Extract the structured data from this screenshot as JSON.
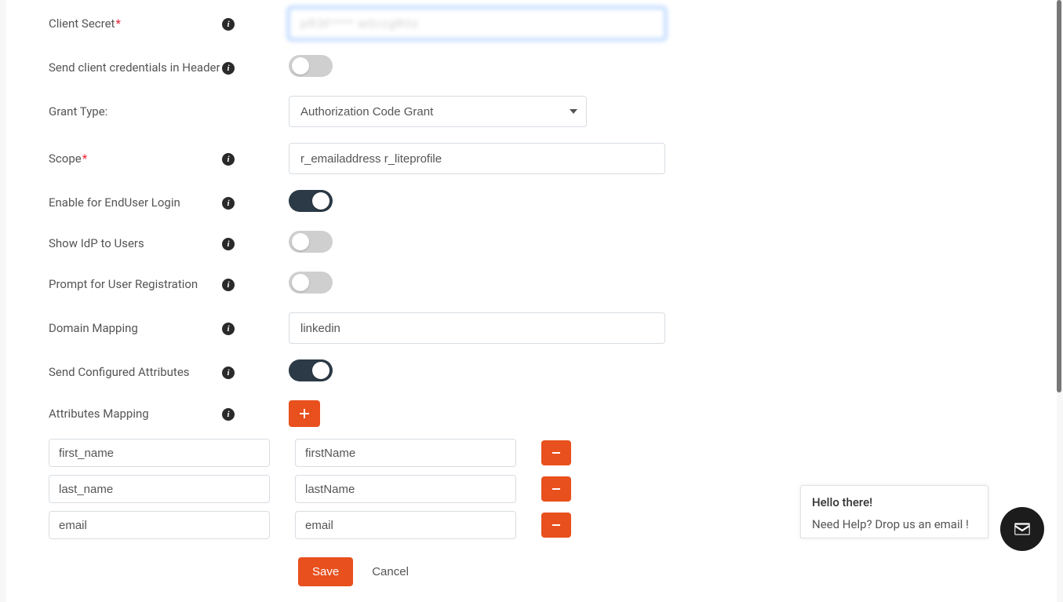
{
  "form": {
    "client_secret": {
      "label": "Client Secret",
      "value": "pR3F**** wGrzgR0z"
    },
    "send_header": {
      "label": "Send client credentials in Header",
      "on": false
    },
    "grant_type": {
      "label": "Grant Type:",
      "selected": "Authorization Code Grant",
      "options": [
        "Authorization Code Grant"
      ]
    },
    "scope": {
      "label": "Scope",
      "value": "r_emailaddress r_liteprofile"
    },
    "enable_enduser": {
      "label": "Enable for EndUser Login",
      "on": true
    },
    "show_idp": {
      "label": "Show IdP to Users",
      "on": false
    },
    "prompt_reg": {
      "label": "Prompt for User Registration",
      "on": false
    },
    "domain_mapping": {
      "label": "Domain Mapping",
      "value": "linkedin"
    },
    "send_configured": {
      "label": "Send Configured Attributes",
      "on": true
    },
    "attr_mapping": {
      "label": "Attributes Mapping"
    }
  },
  "mappings": [
    {
      "local": "first_name",
      "remote": "firstName"
    },
    {
      "local": "last_name",
      "remote": "lastName"
    },
    {
      "local": "email",
      "remote": "email"
    }
  ],
  "actions": {
    "save": "Save",
    "cancel": "Cancel"
  },
  "chat": {
    "greeting": "Hello there!",
    "prompt": "Need Help? Drop us an email !"
  }
}
